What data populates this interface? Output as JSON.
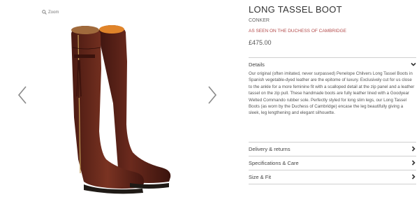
{
  "gallery": {
    "zoom_label": "Zoom",
    "zoom_icon": "search-icon",
    "prev_icon": "chevron-left-icon",
    "next_icon": "chevron-right-icon"
  },
  "product": {
    "title": "LONG TASSEL BOOT",
    "color": "CONKER",
    "as_seen": "AS SEEN ON THE DUCHESS OF CAMBRIDGE",
    "price": "£475.00",
    "accent_color": "#b34a4a"
  },
  "accordion": {
    "details": {
      "label": "Details",
      "icon": "chevron-down-icon",
      "body": "Our original (often imitated, never surpassed) Penelope Chilvers Long Tassel Boots in Spanish vegetable-dyed leather are the epitome of luxury. Exclusively cut for us close to the ankle for a more feminine fit with a scalloped detail at the zip panel and a leather tassel on the zip pull. These handmade boots are fully leather lined with a Goodyear Welted Commando rubber sole. Perfectly styled for long slim legs, our Long Tassel Boots (as worn by the Duchess of Cambridge) encase the leg beautifully giving a sleek, leg lengthening and elegant silhouette."
    },
    "delivery": {
      "label": "Delivery & returns",
      "icon": "chevron-right-icon"
    },
    "specs": {
      "label": "Specifications & Care",
      "icon": "chevron-right-icon"
    },
    "size": {
      "label": "Size & Fit",
      "icon": "chevron-right-icon"
    }
  }
}
